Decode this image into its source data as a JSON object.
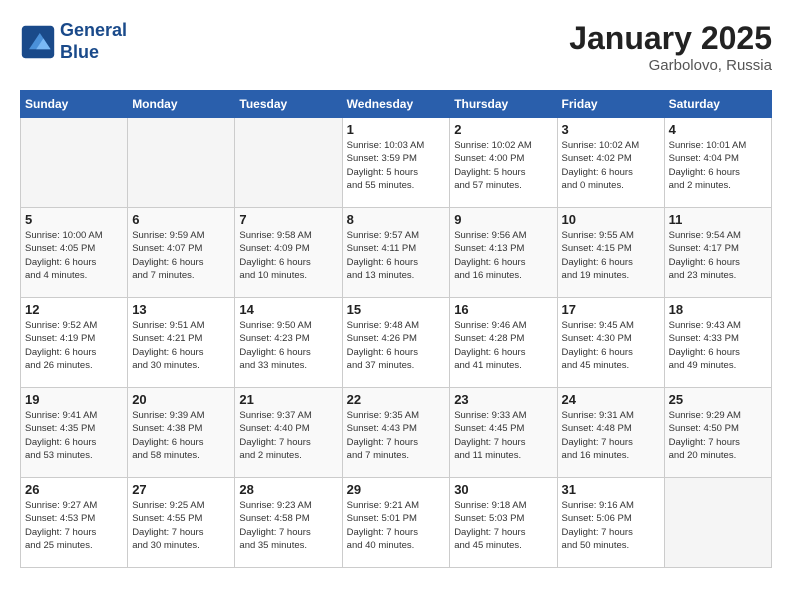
{
  "header": {
    "logo_line1": "General",
    "logo_line2": "Blue",
    "month_title": "January 2025",
    "location": "Garbolovo, Russia"
  },
  "weekdays": [
    "Sunday",
    "Monday",
    "Tuesday",
    "Wednesday",
    "Thursday",
    "Friday",
    "Saturday"
  ],
  "weeks": [
    [
      {
        "day": "",
        "info": ""
      },
      {
        "day": "",
        "info": ""
      },
      {
        "day": "",
        "info": ""
      },
      {
        "day": "1",
        "info": "Sunrise: 10:03 AM\nSunset: 3:59 PM\nDaylight: 5 hours\nand 55 minutes."
      },
      {
        "day": "2",
        "info": "Sunrise: 10:02 AM\nSunset: 4:00 PM\nDaylight: 5 hours\nand 57 minutes."
      },
      {
        "day": "3",
        "info": "Sunrise: 10:02 AM\nSunset: 4:02 PM\nDaylight: 6 hours\nand 0 minutes."
      },
      {
        "day": "4",
        "info": "Sunrise: 10:01 AM\nSunset: 4:04 PM\nDaylight: 6 hours\nand 2 minutes."
      }
    ],
    [
      {
        "day": "5",
        "info": "Sunrise: 10:00 AM\nSunset: 4:05 PM\nDaylight: 6 hours\nand 4 minutes."
      },
      {
        "day": "6",
        "info": "Sunrise: 9:59 AM\nSunset: 4:07 PM\nDaylight: 6 hours\nand 7 minutes."
      },
      {
        "day": "7",
        "info": "Sunrise: 9:58 AM\nSunset: 4:09 PM\nDaylight: 6 hours\nand 10 minutes."
      },
      {
        "day": "8",
        "info": "Sunrise: 9:57 AM\nSunset: 4:11 PM\nDaylight: 6 hours\nand 13 minutes."
      },
      {
        "day": "9",
        "info": "Sunrise: 9:56 AM\nSunset: 4:13 PM\nDaylight: 6 hours\nand 16 minutes."
      },
      {
        "day": "10",
        "info": "Sunrise: 9:55 AM\nSunset: 4:15 PM\nDaylight: 6 hours\nand 19 minutes."
      },
      {
        "day": "11",
        "info": "Sunrise: 9:54 AM\nSunset: 4:17 PM\nDaylight: 6 hours\nand 23 minutes."
      }
    ],
    [
      {
        "day": "12",
        "info": "Sunrise: 9:52 AM\nSunset: 4:19 PM\nDaylight: 6 hours\nand 26 minutes."
      },
      {
        "day": "13",
        "info": "Sunrise: 9:51 AM\nSunset: 4:21 PM\nDaylight: 6 hours\nand 30 minutes."
      },
      {
        "day": "14",
        "info": "Sunrise: 9:50 AM\nSunset: 4:23 PM\nDaylight: 6 hours\nand 33 minutes."
      },
      {
        "day": "15",
        "info": "Sunrise: 9:48 AM\nSunset: 4:26 PM\nDaylight: 6 hours\nand 37 minutes."
      },
      {
        "day": "16",
        "info": "Sunrise: 9:46 AM\nSunset: 4:28 PM\nDaylight: 6 hours\nand 41 minutes."
      },
      {
        "day": "17",
        "info": "Sunrise: 9:45 AM\nSunset: 4:30 PM\nDaylight: 6 hours\nand 45 minutes."
      },
      {
        "day": "18",
        "info": "Sunrise: 9:43 AM\nSunset: 4:33 PM\nDaylight: 6 hours\nand 49 minutes."
      }
    ],
    [
      {
        "day": "19",
        "info": "Sunrise: 9:41 AM\nSunset: 4:35 PM\nDaylight: 6 hours\nand 53 minutes."
      },
      {
        "day": "20",
        "info": "Sunrise: 9:39 AM\nSunset: 4:38 PM\nDaylight: 6 hours\nand 58 minutes."
      },
      {
        "day": "21",
        "info": "Sunrise: 9:37 AM\nSunset: 4:40 PM\nDaylight: 7 hours\nand 2 minutes."
      },
      {
        "day": "22",
        "info": "Sunrise: 9:35 AM\nSunset: 4:43 PM\nDaylight: 7 hours\nand 7 minutes."
      },
      {
        "day": "23",
        "info": "Sunrise: 9:33 AM\nSunset: 4:45 PM\nDaylight: 7 hours\nand 11 minutes."
      },
      {
        "day": "24",
        "info": "Sunrise: 9:31 AM\nSunset: 4:48 PM\nDaylight: 7 hours\nand 16 minutes."
      },
      {
        "day": "25",
        "info": "Sunrise: 9:29 AM\nSunset: 4:50 PM\nDaylight: 7 hours\nand 20 minutes."
      }
    ],
    [
      {
        "day": "26",
        "info": "Sunrise: 9:27 AM\nSunset: 4:53 PM\nDaylight: 7 hours\nand 25 minutes."
      },
      {
        "day": "27",
        "info": "Sunrise: 9:25 AM\nSunset: 4:55 PM\nDaylight: 7 hours\nand 30 minutes."
      },
      {
        "day": "28",
        "info": "Sunrise: 9:23 AM\nSunset: 4:58 PM\nDaylight: 7 hours\nand 35 minutes."
      },
      {
        "day": "29",
        "info": "Sunrise: 9:21 AM\nSunset: 5:01 PM\nDaylight: 7 hours\nand 40 minutes."
      },
      {
        "day": "30",
        "info": "Sunrise: 9:18 AM\nSunset: 5:03 PM\nDaylight: 7 hours\nand 45 minutes."
      },
      {
        "day": "31",
        "info": "Sunrise: 9:16 AM\nSunset: 5:06 PM\nDaylight: 7 hours\nand 50 minutes."
      },
      {
        "day": "",
        "info": ""
      }
    ]
  ]
}
